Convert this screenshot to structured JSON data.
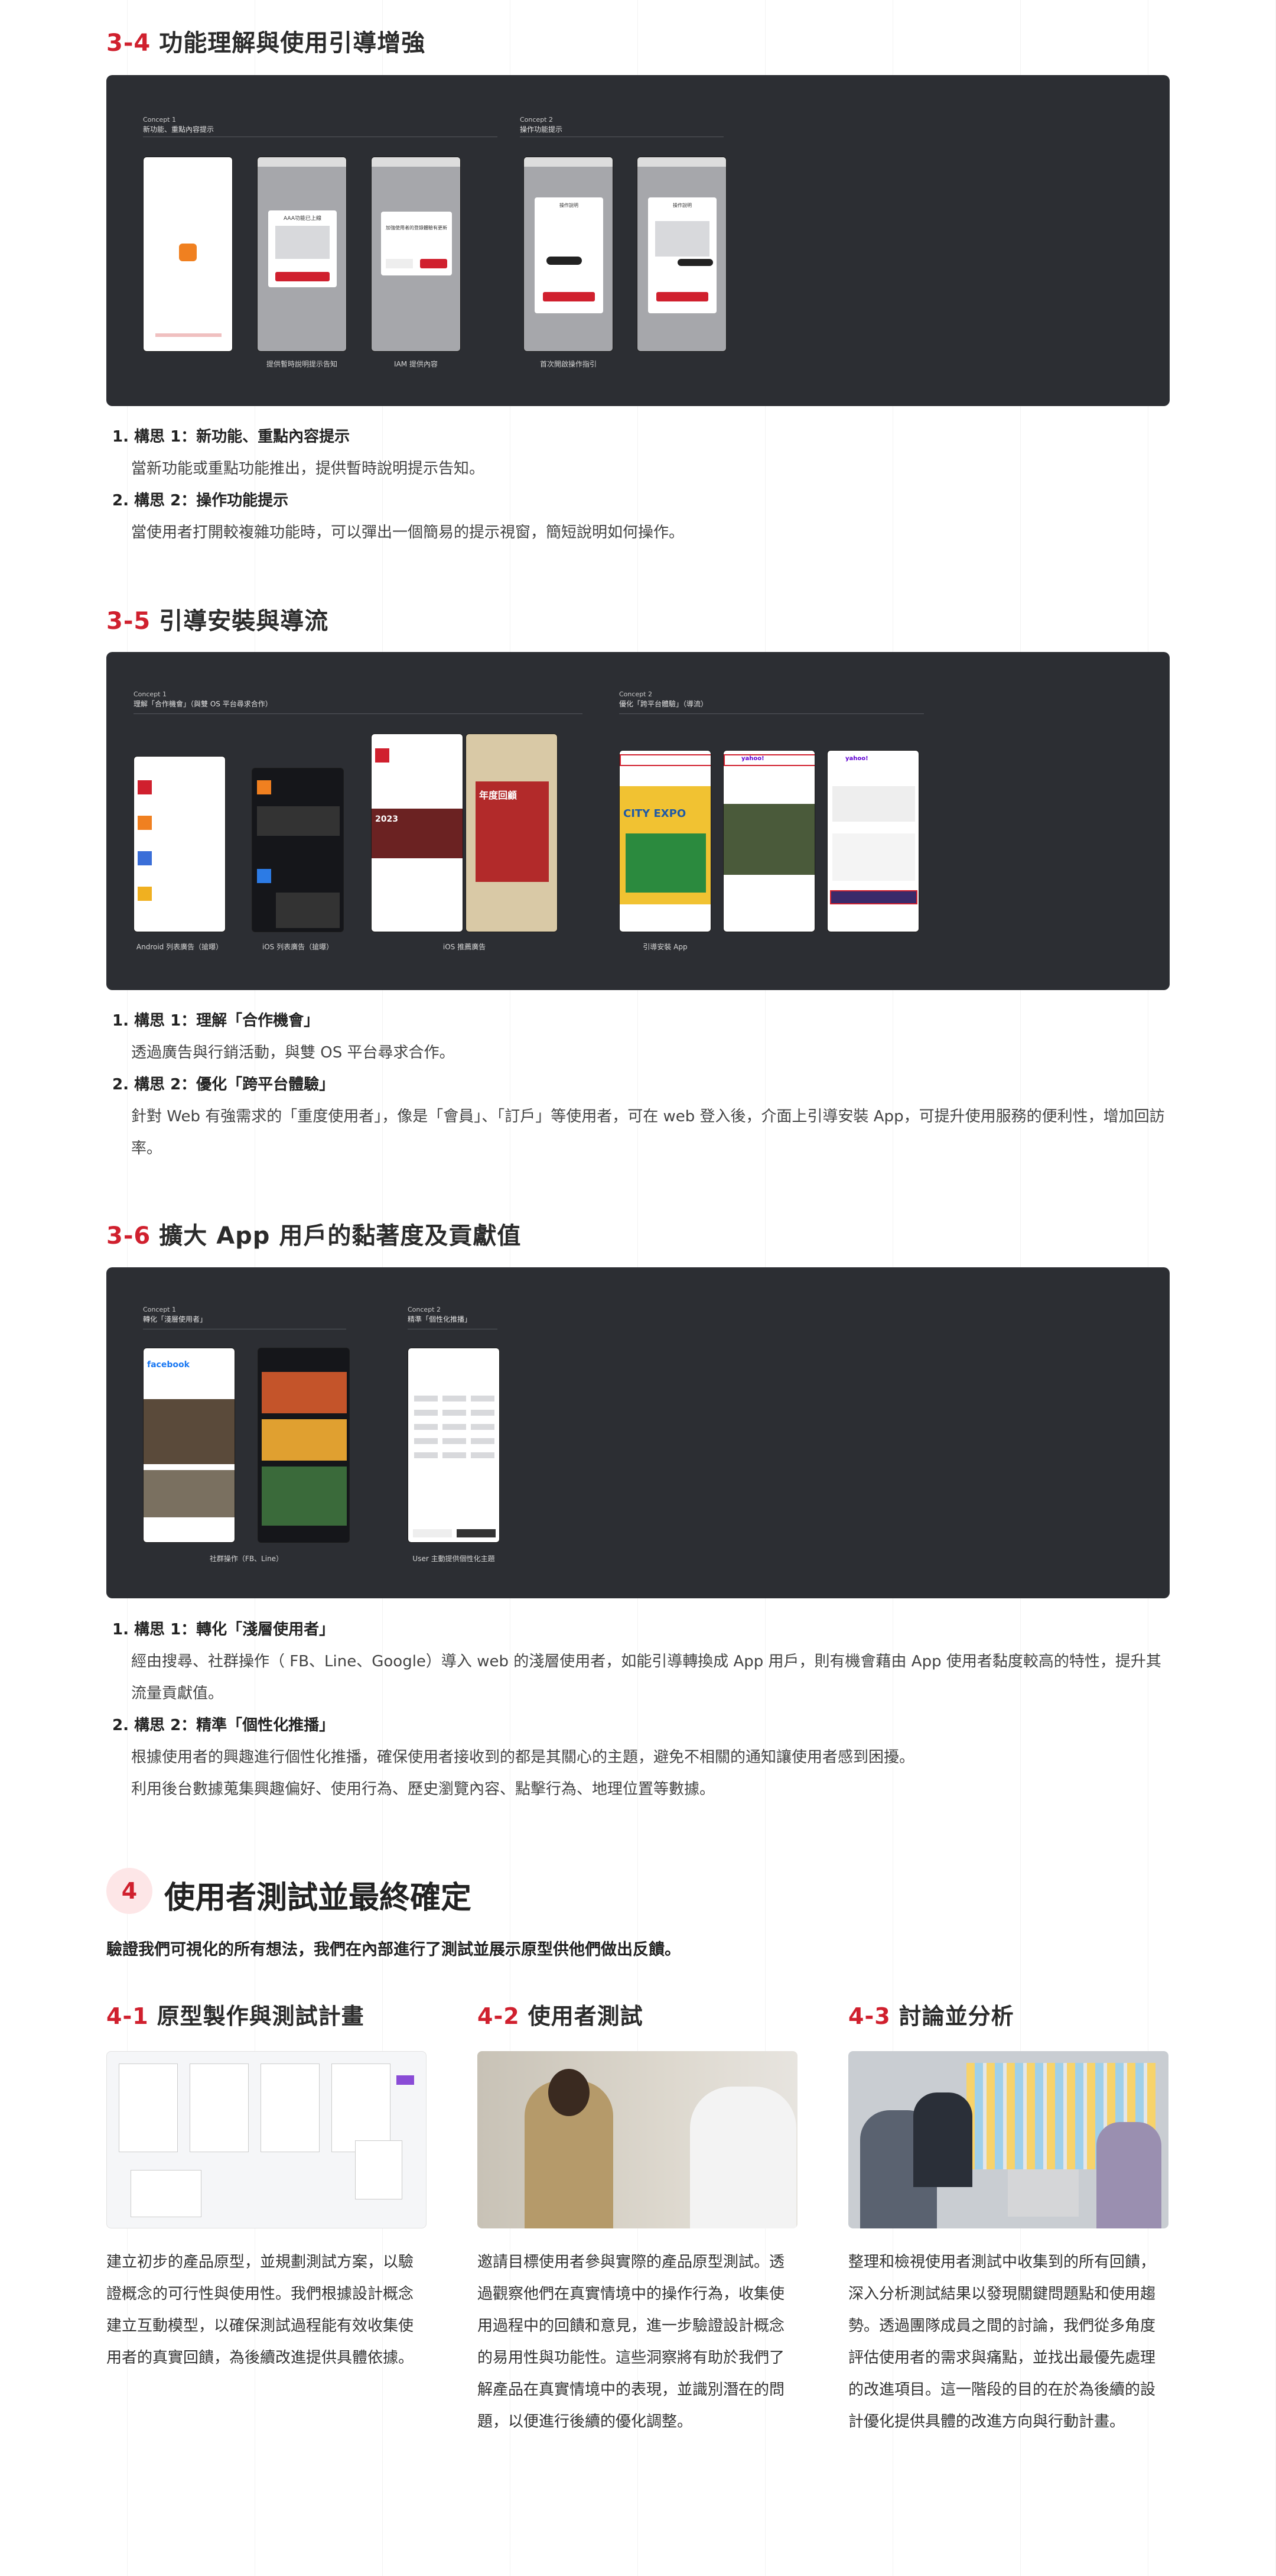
{
  "s34": {
    "num": "3-4",
    "title": "功能理解與使用引導增強",
    "items": [
      {
        "t": "1. 構思 1：新功能、重點內容提示",
        "d": "當新功能或重點功能推出，提供暫時說明提示告知。"
      },
      {
        "t": "2. 構思 2：操作功能提示",
        "d": "當使用者打開較複雜功能時，可以彈出一個簡易的提示視窗，簡短說明如何操作。"
      }
    ],
    "c1": {
      "l1": "Concept 1",
      "l2": "新功能、重點內容提示"
    },
    "c2": {
      "l1": "Concept 2",
      "l2": "操作功能提示"
    },
    "cap1": "提供暫時說明提示告知",
    "cap2": "IAM 提供內容",
    "cap3": "首次開啟操作指引",
    "m1": "AAA功能已上線",
    "m2": "加強使用者的登錄體驗有更新",
    "m3": "操作說明",
    "m4": "按住拖曳到此處",
    "btn": "開始使用",
    "b1": "取消",
    "b2": "立即更新"
  },
  "s35": {
    "num": "3-5",
    "title": "引導安裝與導流",
    "items": [
      {
        "t": "1. 構思 1：理解「合作機會」",
        "d": "透過廣告與行銷活動，與雙 OS 平台尋求合作。"
      },
      {
        "t": "2. 構思 2：優化「跨平台體驗」",
        "d": "針對 Web 有強需求的「重度使用者」，像是「會員」、「訂戶」等使用者，可在 web 登入後，介面上引導安裝 App，可提升使用服務的便利性，增加回訪率。"
      }
    ],
    "c1": {
      "l1": "Concept 1",
      "l2": "理解「合作機會」（與雙 OS 平台尋求合作）"
    },
    "c2": {
      "l1": "Concept 2",
      "l2": "優化「跨平台體驗」（導流）"
    },
    "cap1": "Android 列表廣告（搶曝）",
    "cap2": "iOS 列表廣告（搶曝）",
    "cap3": "iOS 推薦廣告",
    "cap4": "引導安裝 App",
    "expo": "CITY EXPO",
    "news": "年度回顧",
    "yr": "2023",
    "yahoo": "yahoo!"
  },
  "s36": {
    "num": "3-6",
    "title": "擴大 App 用戶的黏著度及貢獻值",
    "items": [
      {
        "t": "1. 構思 1：轉化「淺層使用者」",
        "d": "經由搜尋、社群操作（ FB、Line、Google）導入 web 的淺層使用者，如能引導轉換成 App 用戶，則有機會藉由 App 使用者黏度較高的特性，提升其流量貢獻值。"
      },
      {
        "t": "2. 構思 2：精準「個性化推播」",
        "d": "根據使用者的興趣進行個性化推播，確保使用者接收到的都是其關心的主題，避免不相關的通知讓使用者感到困擾。",
        "d2": "利用後台數據蒐集興趣偏好、使用行為、歷史瀏覽內容、點擊行為、地理位置等數據。"
      }
    ],
    "c1": {
      "l1": "Concept 1",
      "l2": "轉化「淺層使用者」"
    },
    "c2": {
      "l1": "Concept 2",
      "l2": "精準「個性化推播」"
    },
    "cap1": "社群操作（FB、Line）",
    "cap2": "User 主動提供個性化主題",
    "fb": "facebook"
  },
  "s4": {
    "num": "4",
    "title": "使用者測試並最終確定",
    "sub": "驗證我們可視化的所有想法，我們在內部進行了測試並展示原型供他們做出反饋。",
    "cols": [
      {
        "num": "4-1",
        "title": "原型製作與測試計畫",
        "p": "建立初步的產品原型，並規劃測試方案，以驗證概念的可行性與使用性。我們根據設計概念建立互動模型，以確保測試過程能有效收集使用者的真實回饋，為後續改進提供具體依據。"
      },
      {
        "num": "4-2",
        "title": "使用者測試",
        "p": "邀請目標使用者參與實際的產品原型測試。透過觀察他們在真實情境中的操作行為，收集使用過程中的回饋和意見，進一步驗證設計概念的易用性與功能性。這些洞察將有助於我們了解產品在真實情境中的表現，並識別潛在的問題，以便進行後續的優化調整。"
      },
      {
        "num": "4-3",
        "title": "討論並分析",
        "p": "整理和檢視使用者測試中收集到的所有回饋，深入分析測試結果以發現關鍵問題點和使用趨勢。透過團隊成員之間的討論，我們從多角度評估使用者的需求與痛點，並找出最優先處理的改進項目。這一階段的目的在於為後續的設計優化提供具體的改進方向與行動計畫。"
      }
    ]
  },
  "colors": {
    "accent": "#d0202e",
    "dark": "#2c2e33",
    "badge": "#fde6e7"
  }
}
